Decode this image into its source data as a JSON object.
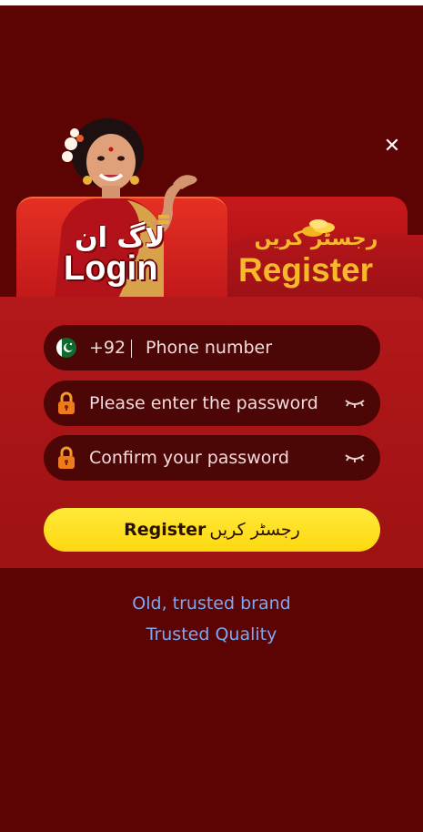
{
  "header": {
    "close_icon": "close-icon",
    "login_tab": {
      "urdu": "لاگ ان",
      "label": "Login"
    },
    "register_tab": {
      "urdu": "رجسٹر کریں",
      "label": "Register"
    }
  },
  "form": {
    "phone": {
      "flag_icon": "pakistan-flag-icon",
      "country_code": "+92",
      "placeholder": "Phone number"
    },
    "password": {
      "lock_icon": "lock-icon",
      "placeholder": "Please enter the password",
      "toggle_icon": "eye-closed-icon"
    },
    "confirm_password": {
      "lock_icon": "lock-icon",
      "placeholder": "Confirm your password",
      "toggle_icon": "eye-closed-icon"
    },
    "submit": {
      "label": "Register",
      "urdu": "رجسٹر کریں"
    }
  },
  "footer": {
    "line1": "Old, trusted brand",
    "line2": "Trusted Quality"
  },
  "colors": {
    "background": "#5c0303",
    "panel": "#b3181a",
    "field": "#4c0606",
    "accent_gold": "#f7b92a",
    "button_yellow": "#fdd80f",
    "link_blue": "#7aa9f2"
  }
}
